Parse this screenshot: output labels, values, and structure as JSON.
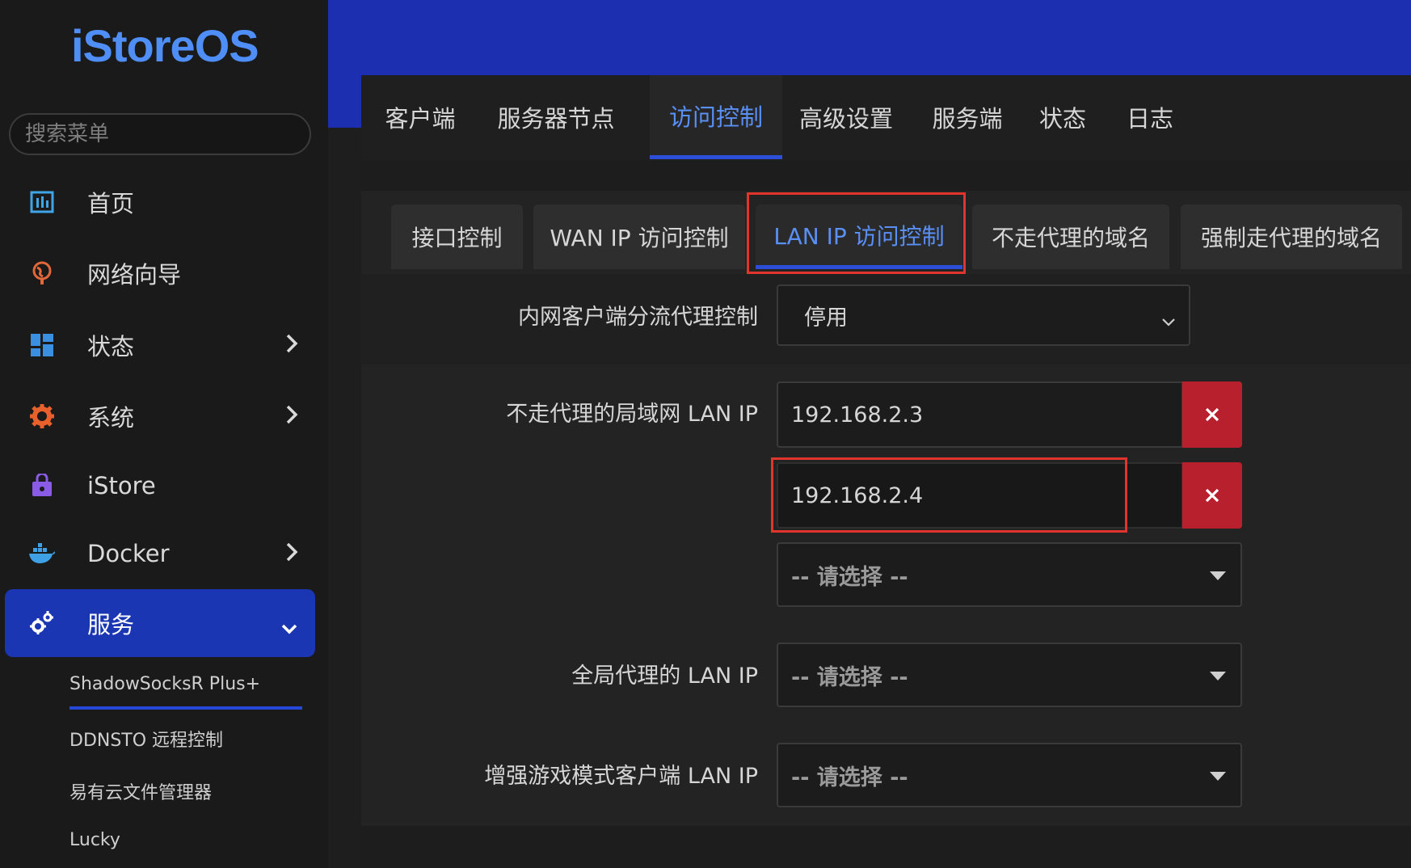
{
  "app": {
    "logo": "iStoreOS"
  },
  "sidebar": {
    "search_placeholder": "搜索菜单",
    "items": [
      {
        "label": "首页",
        "icon": "dashboard-icon",
        "color": "#3fa5e6"
      },
      {
        "label": "网络向导",
        "icon": "globe-icon",
        "color": "#e2673b"
      },
      {
        "label": "状态",
        "icon": "grid-icon",
        "color": "#3b8fe0"
      },
      {
        "label": "系统",
        "icon": "gear-icon",
        "color": "#e8612c"
      },
      {
        "label": "iStore",
        "icon": "bag-icon",
        "color": "#8a5ce6"
      },
      {
        "label": "Docker",
        "icon": "docker-icon",
        "color": "#3fa0e6"
      },
      {
        "label": "服务",
        "icon": "services-icon",
        "color": "#ffffff"
      }
    ],
    "sub_items": [
      {
        "label": "ShadowSocksR Plus+"
      },
      {
        "label": "DDNSTO 远程控制"
      },
      {
        "label": "易有云文件管理器"
      },
      {
        "label": "Lucky"
      }
    ]
  },
  "tabs": [
    {
      "label": "客户端"
    },
    {
      "label": "服务器节点"
    },
    {
      "label": "访问控制"
    },
    {
      "label": "高级设置"
    },
    {
      "label": "服务端"
    },
    {
      "label": "状态"
    },
    {
      "label": "日志"
    }
  ],
  "subtabs": [
    {
      "label": "接口控制"
    },
    {
      "label": "WAN IP 访问控制"
    },
    {
      "label": "LAN IP 访问控制"
    },
    {
      "label": "不走代理的域名"
    },
    {
      "label": "强制走代理的域名"
    }
  ],
  "form": {
    "split_control": {
      "label": "内网客户端分流代理控制",
      "value": "停用"
    },
    "bypass_lan_ip": {
      "label": "不走代理的局域网 LAN IP",
      "values": [
        "192.168.2.3",
        "192.168.2.4"
      ],
      "add_placeholder": "-- 请选择 --"
    },
    "global_lan_ip": {
      "label": "全局代理的 LAN IP",
      "placeholder": "-- 请选择 --"
    },
    "game_mode_lan_ip": {
      "label": "增强游戏模式客户端 LAN IP",
      "placeholder": "-- 请选择 --"
    }
  },
  "colors": {
    "accent": "#2c4ed8",
    "link": "#5a8ff5",
    "danger": "#b7202c",
    "highlight": "#e0342c"
  }
}
